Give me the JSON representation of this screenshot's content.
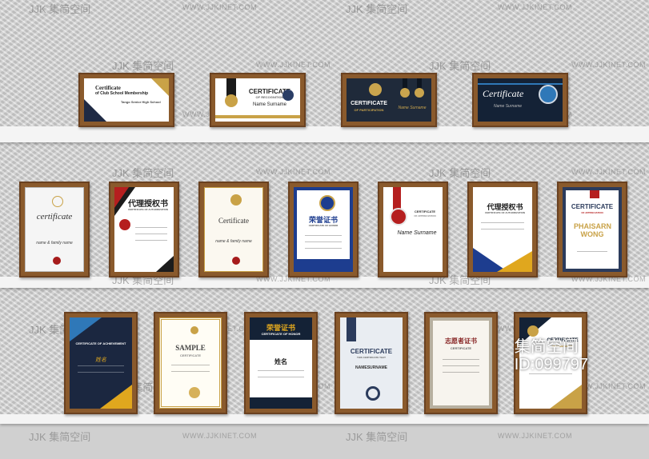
{
  "watermark": {
    "site": "WWW.JJKINET.COM",
    "logo": "JJK 集简空间"
  },
  "badge": {
    "line1": "集简空间",
    "line2": "ID:099797"
  },
  "shelf_top": [
    {
      "title": "Certificate",
      "subtitle": "of Club School Membership",
      "name": "Tango Senior High School"
    },
    {
      "title": "CERTIFICATE",
      "subtitle": "OF RECOGNITION",
      "name": "Name Surname"
    },
    {
      "title": "CERTIFICATE",
      "subtitle": "OF PARTICIPATION",
      "name": "Name Surname"
    },
    {
      "title": "Certificate",
      "subtitle": "",
      "name": "Name Surname"
    }
  ],
  "shelf_middle": [
    {
      "title": "certificate",
      "name": "name & family name"
    },
    {
      "title": "代理授权书",
      "subtitle": "CERTIFICATE OF AUTHORIZATION"
    },
    {
      "title": "Certificate",
      "name": "name & family name"
    },
    {
      "title": "荣誉证书",
      "subtitle": "CERTIFICATE OF HONOR"
    },
    {
      "title": "CERTIFICATE",
      "subtitle": "OF APPRECIATION",
      "name": "Name Surname"
    },
    {
      "title": "代理授权书",
      "subtitle": "CERTIFICATE OF AUTHORIZATION"
    },
    {
      "title": "CERTIFICATE",
      "subtitle": "OF APPRECIATION",
      "name": "PHAISARN WONG"
    }
  ],
  "shelf_bottom": [
    {
      "title": "CERTIFICATE OF ACHIEVEMENT",
      "name": "姓名"
    },
    {
      "title": "SAMPLE",
      "subtitle": "CERTIFICATE"
    },
    {
      "title": "荣誉证书",
      "subtitle": "CERTIFICATE OF HONOR",
      "name": "姓名"
    },
    {
      "title": "CERTIFICATE",
      "subtitle": "THIS CERTIFICATE THAT",
      "name": "NAMESURNAME"
    },
    {
      "title": "志愿者证书",
      "subtitle": "CERTIFICATE"
    },
    {
      "title": "CERTIFICATE",
      "subtitle": "OF ACHIEVEMENT"
    }
  ]
}
